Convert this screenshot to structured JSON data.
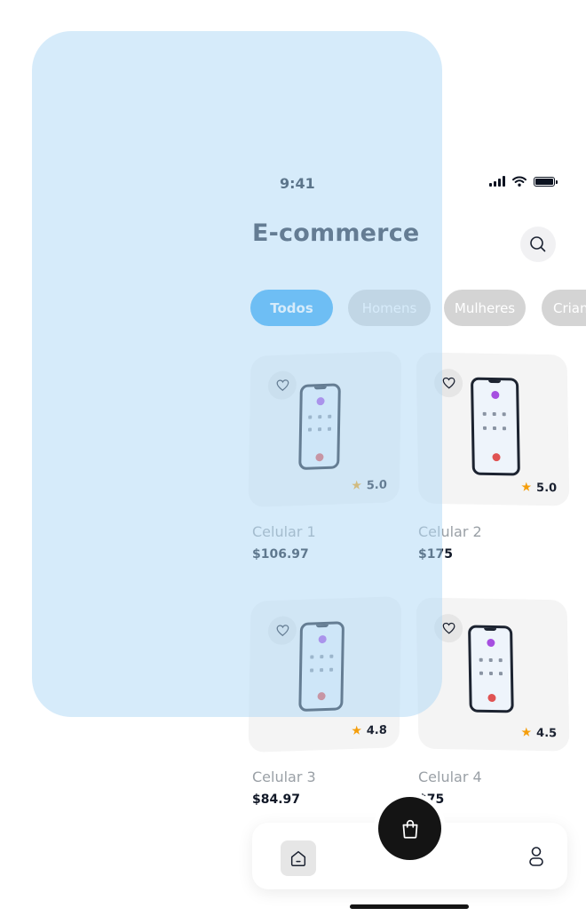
{
  "status_bar": {
    "time": "9:41",
    "icons": [
      "signal-icon",
      "wifi-icon",
      "battery-icon"
    ]
  },
  "header": {
    "title": "E-commerce",
    "search_icon": "search-icon"
  },
  "categories": [
    {
      "label": "Todos",
      "active": true
    },
    {
      "label": "Homens",
      "active": false
    },
    {
      "label": "Mulheres",
      "active": false
    },
    {
      "label": "Crian",
      "active": false
    }
  ],
  "products": [
    {
      "name": "Celular 1",
      "price": "$106.97",
      "rating": "5.0"
    },
    {
      "name": "Celular 2",
      "price": "$175",
      "rating": "5.0"
    },
    {
      "name": "Celular 3",
      "price": "$84.97",
      "rating": "4.8"
    },
    {
      "name": "Celular 4",
      "price": "$75",
      "rating": "4.5"
    }
  ],
  "bottom_nav": {
    "items": [
      "home-icon",
      "cart-icon",
      "profile-icon"
    ]
  },
  "colors": {
    "accent": "#2ea4f2",
    "chip_inactive": "#d4d4d4",
    "card_bg": "#f4f4f4",
    "overlay": "#d6ebf8",
    "star": "#f59e0b"
  }
}
